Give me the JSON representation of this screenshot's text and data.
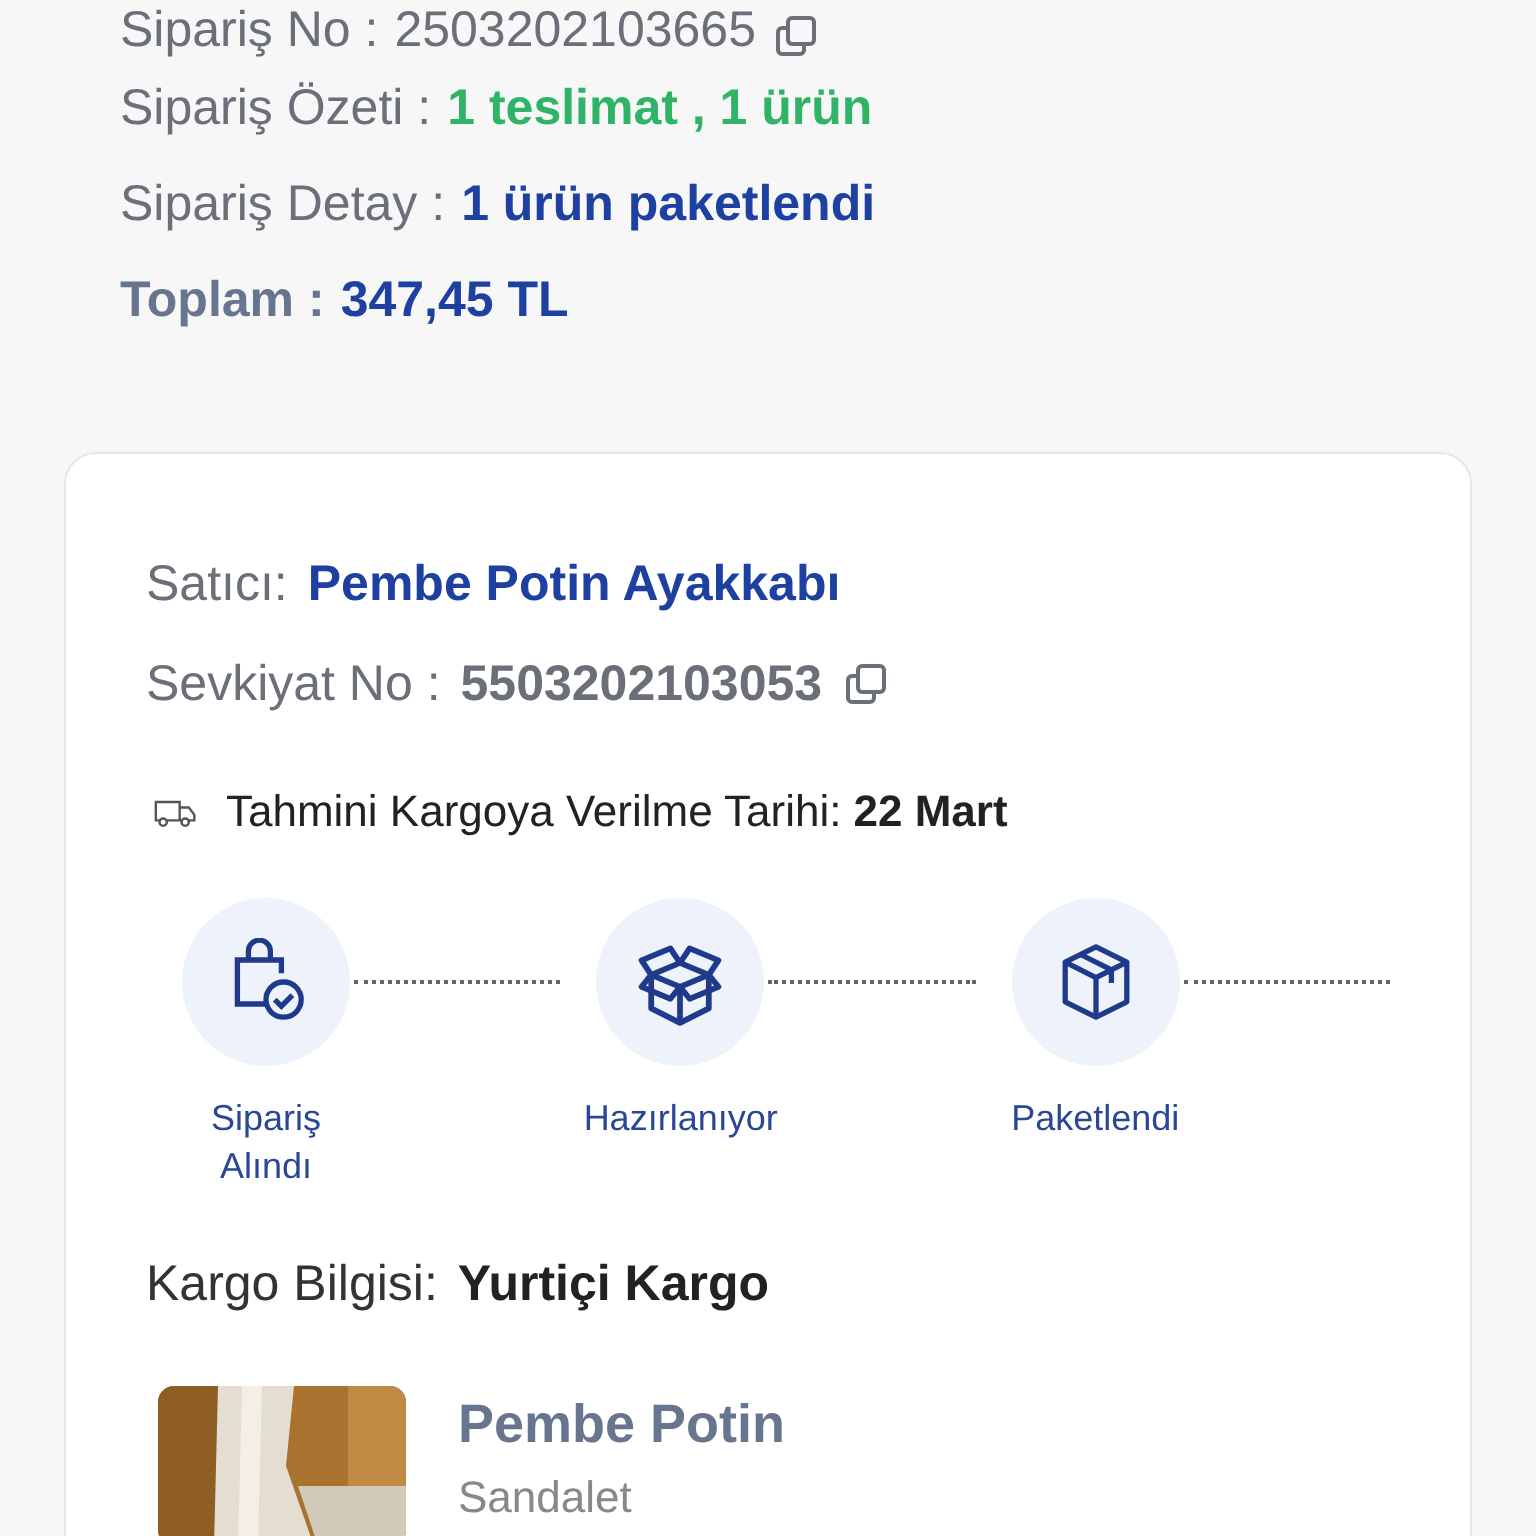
{
  "order": {
    "rows": [
      {
        "kind": "copy",
        "label": "Sipariş No :",
        "value": "2503202103665"
      },
      {
        "kind": "green",
        "label": "Sipariş Özeti :",
        "value": "1 teslimat , 1 ürün"
      },
      {
        "kind": "blue",
        "label": "Sipariş Detay :",
        "value": "1 ürün paketlendi"
      },
      {
        "kind": "total",
        "label": "Toplam :",
        "value": "347,45 TL"
      }
    ]
  },
  "shipment": {
    "seller_label": "Satıcı:",
    "seller": "Pembe Potin Ayakkabı",
    "shipment_label": "Sevkiyat No :",
    "shipment_no": "5503202103053",
    "estimate_label": "Tahmini Kargoya Verilme Tarihi:",
    "estimate_date": "22 Mart",
    "steps": [
      {
        "kind": "bag-check",
        "label": "Sipariş Alındı"
      },
      {
        "kind": "open-box",
        "label": "Hazırlanıyor"
      },
      {
        "kind": "box",
        "label": "Paketlendi"
      }
    ],
    "cargo_label": "Kargo Bilgisi:",
    "cargo": "Yurtiçi Kargo",
    "product": {
      "kind": "picture",
      "title": "Pembe Potin",
      "subtitle": "Sandalet"
    }
  }
}
